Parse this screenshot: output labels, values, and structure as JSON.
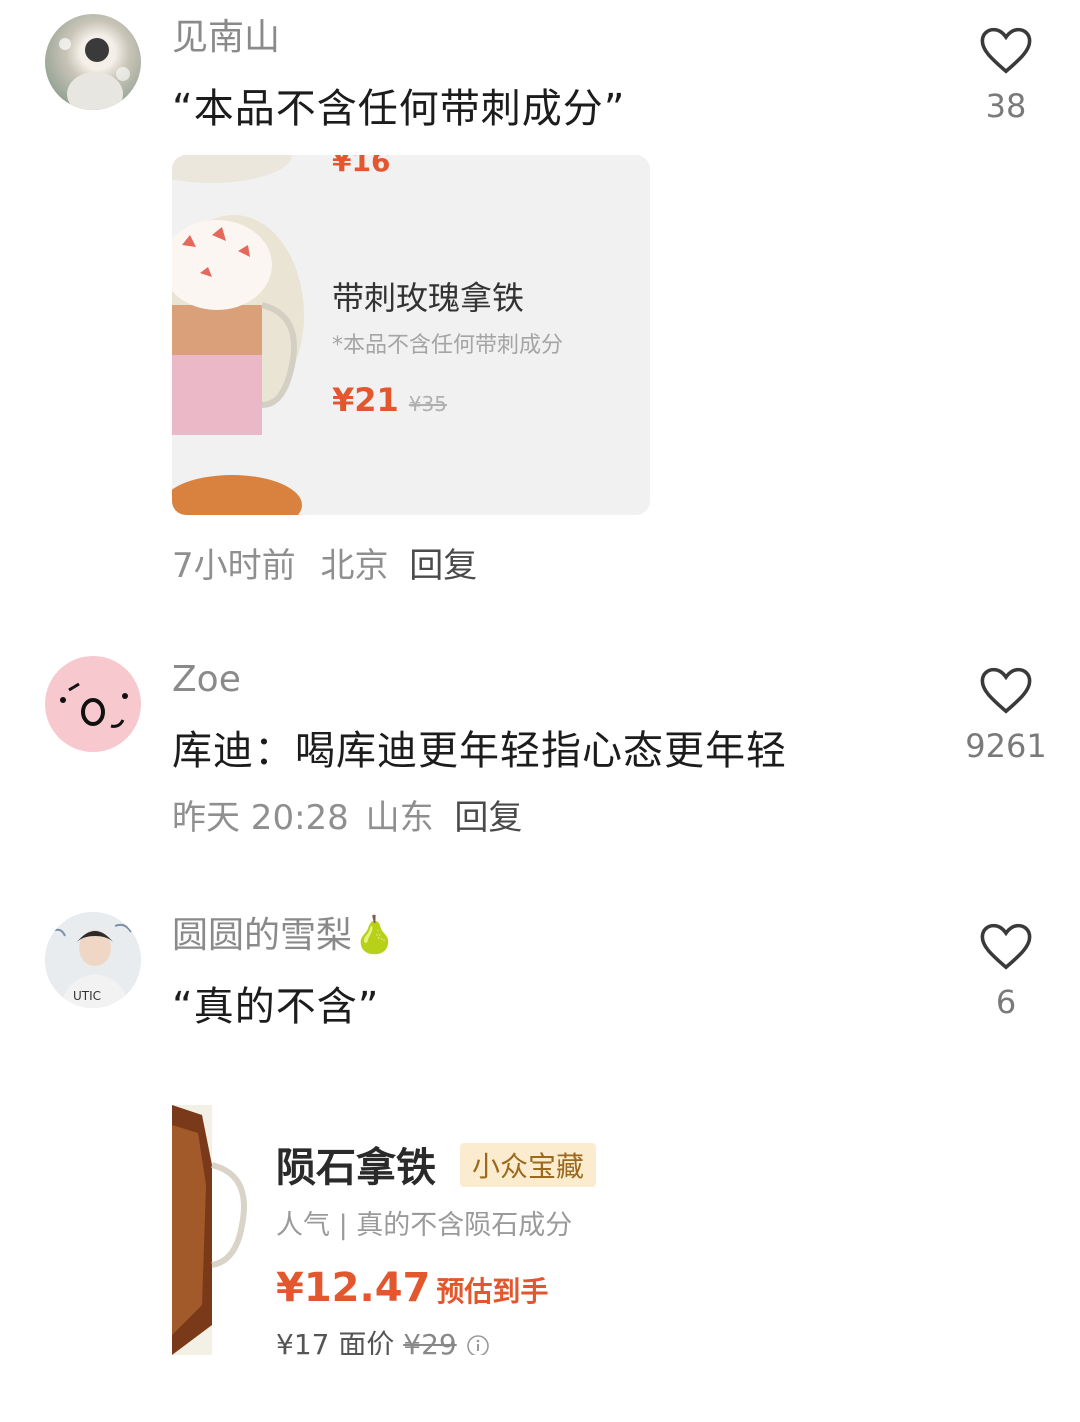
{
  "comments": [
    {
      "username": "见南山",
      "text": "“本品不含任何带刺成分”",
      "likes": "38",
      "meta_time": "7小时前",
      "meta_location": "北京",
      "reply": "回复",
      "card": {
        "top_price": "¥16",
        "name": "带刺玫瑰拿铁",
        "note": "*本品不含任何带刺成分",
        "price": "¥21",
        "old_price": "¥35"
      }
    },
    {
      "username": "Zoe",
      "text": "库迪：喝库迪更年轻指心态更年轻",
      "likes": "9261",
      "meta_time": "昨天 20:28",
      "meta_location": "山东",
      "reply": "回复"
    },
    {
      "username": "圆圆的雪梨🍐",
      "text": "“真的不含”",
      "likes": "6",
      "card": {
        "name": "陨石拿铁",
        "tag": "小众宝藏",
        "sub": "人气 | 真的不含陨石成分",
        "price": "¥12.47",
        "price_suffix": "预估到手",
        "face": "¥17 面价",
        "face_old": "¥29"
      }
    }
  ],
  "colors": {
    "accent": "#e2572e",
    "meta": "#8f8f8f",
    "tag_bg": "#fbecd0"
  },
  "icons": {
    "like": "heart-outline-icon",
    "info": "info-icon"
  }
}
